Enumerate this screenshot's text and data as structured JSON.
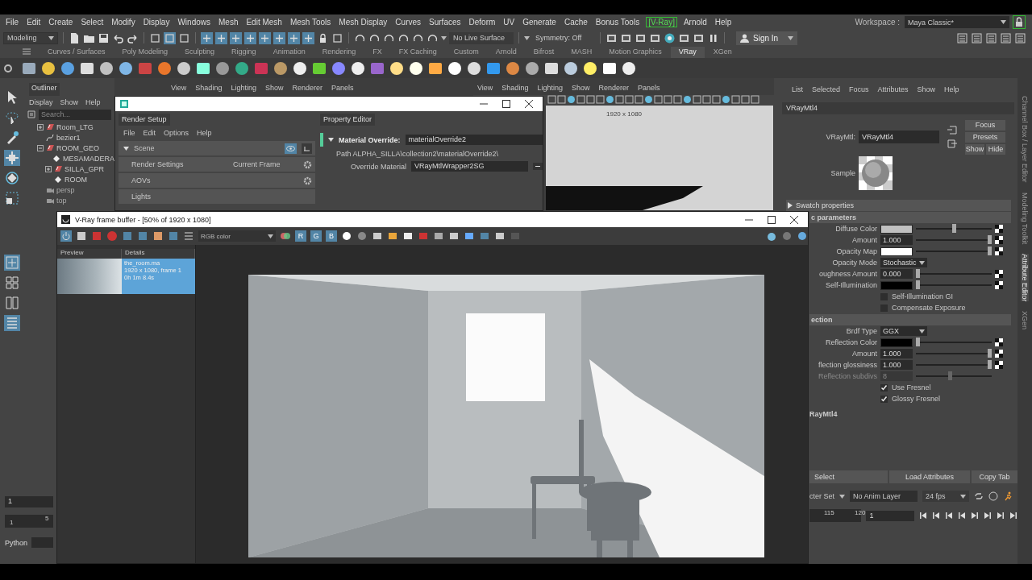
{
  "menu_bar": {
    "items": [
      {
        "label": "File",
        "kind": "menu"
      },
      {
        "label": "Edit",
        "kind": "menu"
      },
      {
        "label": "Create",
        "kind": "menu"
      },
      {
        "label": "Select",
        "kind": "menu"
      },
      {
        "label": "Modify",
        "kind": "menu"
      },
      {
        "label": "Display",
        "kind": "menu"
      },
      {
        "label": "Windows",
        "kind": "menu"
      },
      {
        "label": "Mesh",
        "kind": "menu"
      },
      {
        "label": "Edit Mesh",
        "kind": "menu"
      },
      {
        "label": "Mesh Tools",
        "kind": "menu"
      },
      {
        "label": "Mesh Display",
        "kind": "menu"
      },
      {
        "label": "Curves",
        "kind": "menu"
      },
      {
        "label": "Surfaces",
        "kind": "menu"
      },
      {
        "label": "Deform",
        "kind": "menu"
      },
      {
        "label": "UV",
        "kind": "menu"
      },
      {
        "label": "Generate",
        "kind": "menu"
      },
      {
        "label": "Cache",
        "kind": "menu"
      },
      {
        "label": "Bonus Tools",
        "kind": "menu"
      },
      {
        "label": "[V-Ray]",
        "kind": "plugin"
      },
      {
        "label": "Arnold",
        "kind": "menu"
      },
      {
        "label": "Help",
        "kind": "menu"
      }
    ],
    "workspace_label": "Workspace :",
    "workspace": "Maya Classic*"
  },
  "status_line": {
    "mode": "Modeling",
    "live_surface": "No Live Surface",
    "symmetry": "Symmetry: Off",
    "sign_in": "Sign In"
  },
  "shelf": {
    "tabs": [
      {
        "label": "Curves / Surfaces",
        "selected": false
      },
      {
        "label": "Poly Modeling",
        "selected": false
      },
      {
        "label": "Sculpting",
        "selected": false
      },
      {
        "label": "Rigging",
        "selected": false
      },
      {
        "label": "Animation",
        "selected": false
      },
      {
        "label": "Rendering",
        "selected": false
      },
      {
        "label": "FX",
        "selected": false
      },
      {
        "label": "FX Caching",
        "selected": false
      },
      {
        "label": "Custom",
        "selected": false
      },
      {
        "label": "Arnold",
        "selected": false
      },
      {
        "label": "Bifrost",
        "selected": false
      },
      {
        "label": "MASH",
        "selected": false
      },
      {
        "label": "Motion Graphics",
        "selected": false
      },
      {
        "label": "VRay",
        "selected": true
      },
      {
        "label": "XGen",
        "selected": false
      }
    ]
  },
  "outliner": {
    "title": "Outliner",
    "menu": [
      "Display",
      "Show",
      "Help"
    ],
    "search": {
      "placeholder": "Search..."
    },
    "tree": [
      {
        "label": "Room_LTG",
        "kind": "group",
        "expanded": false
      },
      {
        "label": "bezier1",
        "kind": "curve"
      },
      {
        "label": "ROOM_GEO",
        "kind": "group",
        "expanded": true,
        "children": [
          {
            "label": "MESAMADERA",
            "kind": "mesh"
          },
          {
            "label": "SILLA_GPR",
            "kind": "group",
            "expanded": false
          },
          {
            "label": "ROOM",
            "kind": "mesh"
          }
        ]
      },
      {
        "label": "persp",
        "kind": "camera"
      },
      {
        "label": "top",
        "kind": "camera"
      }
    ]
  },
  "viewports": [
    {
      "menu": [
        "View",
        "Shading",
        "Lighting",
        "Show",
        "Renderer",
        "Panels"
      ]
    },
    {
      "menu": [
        "View",
        "Shading",
        "Lighting",
        "Show",
        "Renderer",
        "Panels"
      ],
      "resolution": "1920 x 1080"
    }
  ],
  "render_setup_window": {
    "render_setup": {
      "title": "Render Setup",
      "menu": [
        "File",
        "Edit",
        "Options",
        "Help"
      ],
      "layers": [
        {
          "label": "Scene",
          "kind": "layer"
        },
        {
          "label": "Render Settings",
          "kind": "override",
          "value": "Current Frame"
        },
        {
          "label": "AOVs",
          "kind": "override"
        },
        {
          "label": "Lights",
          "kind": "collection"
        }
      ]
    },
    "property_editor": {
      "title": "Property Editor",
      "override_label": "Material Override:",
      "override_value": "materialOverride2",
      "path_label": "Path",
      "path": "ALPHA_SILLA\\collection2\\materialOverride2\\",
      "material_label": "Override Material",
      "material_value": "VRayMtlWrapper2SG"
    }
  },
  "attribute_editor": {
    "menu": [
      "List",
      "Selected",
      "Focus",
      "Attributes",
      "Show",
      "Help"
    ],
    "tab": "VRayMtl4",
    "node_label": "VRayMtl:",
    "node_value": "VRayMtl4",
    "buttons": [
      "Focus",
      "Presets",
      "Show",
      "Hide"
    ],
    "sample_label": "Sample",
    "sections": [
      {
        "title": "Swatch properties"
      },
      {
        "title": "c parameters",
        "rows": [
          {
            "label": "Diffuse Color",
            "kind": "color",
            "color": "#c0c0c0",
            "level": 0.5
          },
          {
            "label": "Amount",
            "kind": "number",
            "value": "1.000",
            "level": 1,
            "disabled": false
          },
          {
            "label": "Opacity Map",
            "kind": "color",
            "color": "#ffffff",
            "level": 1
          },
          {
            "label": "Opacity Mode",
            "kind": "dropdown",
            "value": "Stochastic"
          },
          {
            "label": "oughness Amount",
            "kind": "number",
            "value": "0.000",
            "level": 0,
            "disabled": false
          },
          {
            "label": "Self-Illumination",
            "kind": "color",
            "color": "#000000",
            "level": 0
          },
          {
            "label": "Self-Illumination GI",
            "kind": "checkbox",
            "checked": false
          },
          {
            "label": "Compensate Exposure",
            "kind": "checkbox",
            "checked": false
          }
        ]
      },
      {
        "title": "ection",
        "rows": [
          {
            "label": "Brdf Type",
            "kind": "dropdown",
            "value": "GGX"
          },
          {
            "label": "Reflection Color",
            "kind": "color",
            "color": "#000000",
            "level": 0
          },
          {
            "label": "Amount",
            "kind": "number",
            "value": "1.000",
            "level": 1,
            "disabled": false
          },
          {
            "label": "flection glossiness",
            "kind": "number",
            "value": "1.000",
            "level": 1,
            "disabled": false
          },
          {
            "label": "Reflection subdivs",
            "kind": "number",
            "value": "8",
            "level": 0.45,
            "disabled": true
          },
          {
            "label": "Use Fresnel",
            "kind": "checkbox",
            "checked": true
          },
          {
            "label": "Glossy Fresnel",
            "kind": "checkbox",
            "checked": true
          }
        ]
      }
    ],
    "bottom_tab": "RayMtl4",
    "actions": [
      "Select",
      "Load Attributes",
      "Copy Tab"
    ],
    "side_tabs": [
      {
        "label": "Channel Box / Layer Editor",
        "selected": false
      },
      {
        "label": "Modeling Toolkit",
        "selected": false
      },
      {
        "label": "Attribute Editor",
        "selected": true
      },
      {
        "label": "XGen",
        "selected": false
      }
    ]
  },
  "frame_buffer": {
    "title": "V-Ray frame buffer - [50% of 1920 x 1080]",
    "channel": "RGB color",
    "channels": [
      {
        "label": "R",
        "on": true
      },
      {
        "label": "G",
        "on": true
      },
      {
        "label": "B",
        "on": true
      }
    ],
    "history_columns": [
      "Preview",
      "Details"
    ],
    "history": [
      {
        "name": "the_room.ma",
        "info": "1920 x 1080, frame 1",
        "time": "0h 1m 8.4s",
        "selected": true
      }
    ]
  },
  "time_controls": {
    "frame": "1",
    "range_start": "1",
    "range_tick": "5",
    "character_set": "cter Set",
    "anim_layer": "No Anim Layer",
    "fps": "24 fps",
    "end_ticks": [
      "115",
      "120"
    ],
    "current_frame": "1"
  },
  "command_line": {
    "label": "Python"
  }
}
